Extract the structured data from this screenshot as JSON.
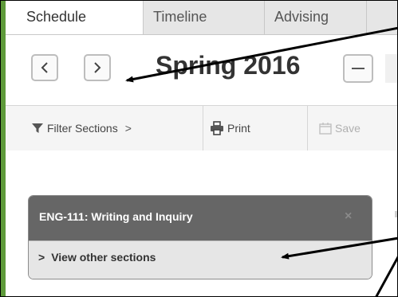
{
  "tabs": [
    {
      "label": "Schedule",
      "active": true
    },
    {
      "label": "Timeline",
      "active": false
    },
    {
      "label": "Advising",
      "active": false
    }
  ],
  "term": {
    "title": "Spring 2016",
    "prev_icon": "chevron-left-icon",
    "next_icon": "chevron-right-icon",
    "collapse_icon": "minus-icon"
  },
  "toolbar": {
    "filter_label": "Filter Sections",
    "filter_icon": "funnel-icon",
    "filter_chevron": ">",
    "print_label": "Print",
    "print_icon": "printer-icon",
    "save_label": "Save",
    "save_icon": "calendar-icon"
  },
  "course_card": {
    "title": "ENG-111: Writing and Inquiry",
    "close_glyph": "×",
    "view_sections_label": "View other sections",
    "view_chevron": ">"
  },
  "colors": {
    "accent_green": "#5e9a3a",
    "card_header": "#666666",
    "card_footer": "#e6e6e6",
    "annotation_arrow": "#000000"
  }
}
